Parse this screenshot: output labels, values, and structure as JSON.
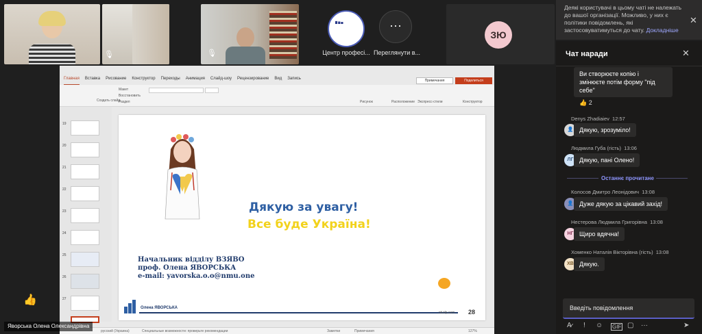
{
  "participants": {
    "center_name": "Центр професі...",
    "more_label": "Переглянути в...",
    "initials": "ЗЮ",
    "presenter_name": "Яворська Олена Олександрівна"
  },
  "ppt": {
    "tabs": [
      "Главная",
      "Вставка",
      "Рисование",
      "Конструктор",
      "Переходы",
      "Анимация",
      "Слайд-шоу",
      "Рецензирование",
      "Вид",
      "Запись"
    ],
    "comments_btn": "Примечания",
    "share_btn": "Поделиться",
    "ribbon_items": [
      "Макет",
      "Восстановить",
      "Раздел",
      "Создать слайд",
      "Рисунок",
      "Расположение",
      "Конструктор",
      "Экспресс-стили"
    ],
    "slide_numbers": [
      "19",
      "20",
      "21",
      "22",
      "23",
      "24",
      "25",
      "26",
      "27"
    ],
    "status_left": "русский (Украина)",
    "status_access": "Специальные возможности: проверьте рекомендации",
    "status_notes": "Заметки",
    "status_comments": "Примечания",
    "zoom": "127%"
  },
  "slide": {
    "title": "Дякую за увагу!",
    "subtitle": "Все буде Україна!",
    "line1": "Начальник відділу ВЗЯВО",
    "line2": "проф. Олена ЯВОРСЬКА",
    "line3": "e-mail: yavorska.o.o@nmu.one",
    "footer_name": "Олена ЯВОРСЬКА",
    "footer_url": "ntudp.com",
    "page": "28"
  },
  "notice": {
    "text": "Деякі користувачі в цьому чаті не належать до вашої організації. Можливо, у них є політики повідомлень, які застосовуватимуться до чату.",
    "link": "Докладніше"
  },
  "chat": {
    "title": "Чат наради",
    "messages": [
      {
        "text1": "Ви створюєте копію і",
        "text2": "змінюєте потім форму \"під",
        "text3": "себе\"",
        "reaction": "2"
      },
      {
        "author": "Denys Zhadiaiev",
        "time": "12:57",
        "text": "Дякую, зрозуміло!"
      },
      {
        "author": "Людмила Губа (гість)",
        "time": "13:06",
        "text": "Дякую, пані Олено!",
        "initials": "ЛГ"
      },
      {
        "author": "Колосов Дмитро Леонідович",
        "time": "13:08",
        "text": "Дуже дякую за цікавий захід!"
      },
      {
        "author": "Нестерова Людмила Григорівна",
        "time": "13:08",
        "text": "Щиро вдячна!",
        "initials": "НГ"
      },
      {
        "author": "Хоменко Наталія Вікторівна (гість)",
        "time": "13:08",
        "text": "Дякую.",
        "initials": "ХВ"
      }
    ],
    "last_read": "Останнє прочитане",
    "input_placeholder": "Введіть повідомлення"
  },
  "colors": {
    "accent": "#5b5fc7",
    "ppt_red": "#b7472a",
    "slide_blue": "#2e5fa3",
    "slide_yellow": "#f2d21c"
  }
}
